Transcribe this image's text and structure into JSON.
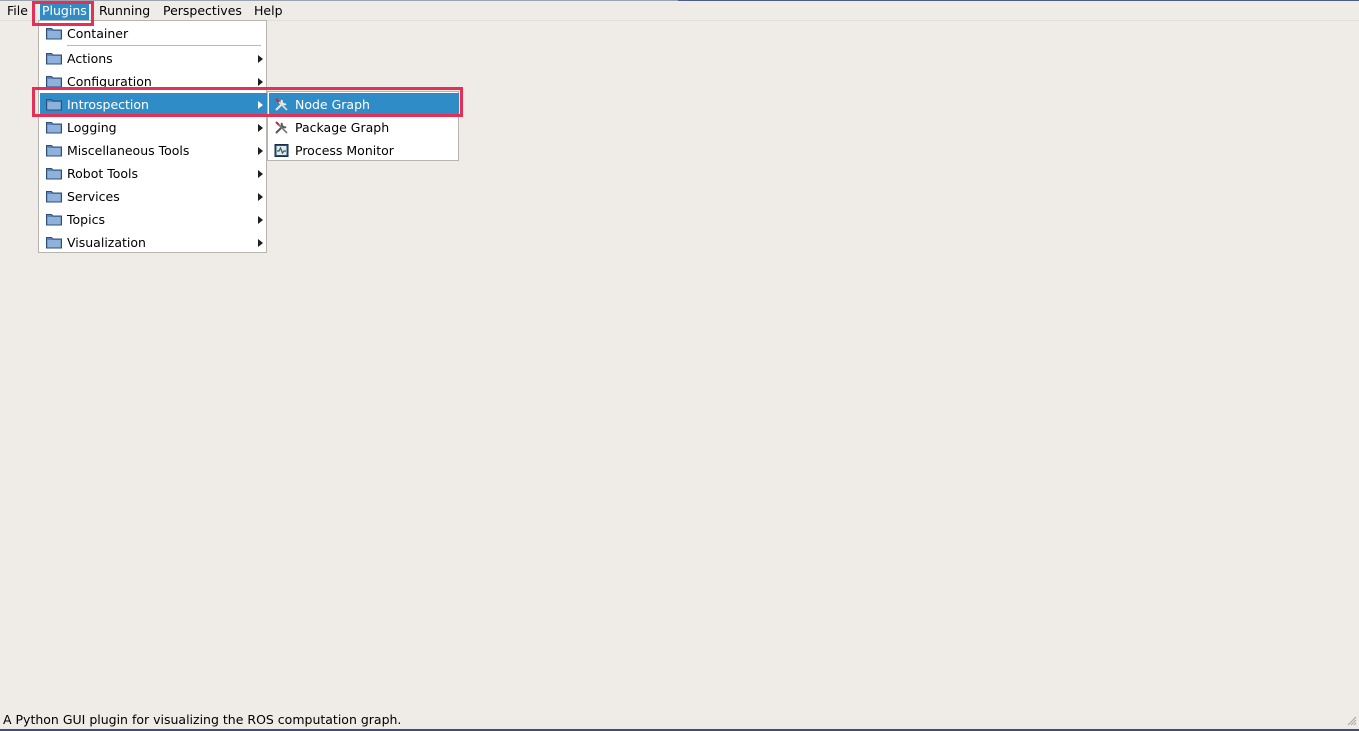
{
  "menubar": {
    "items": [
      {
        "label": "File",
        "mnemonic": "F"
      },
      {
        "label": "Plugins",
        "mnemonic": "P"
      },
      {
        "label": "Running",
        "mnemonic": "R"
      },
      {
        "label": "Perspectives",
        "mnemonic": "P"
      },
      {
        "label": "Help",
        "mnemonic": "H"
      }
    ],
    "active": "Plugins"
  },
  "plugins_menu": {
    "items": [
      {
        "label": "Container",
        "icon": "folder-icon",
        "has_submenu": false
      },
      {
        "label": "Actions",
        "icon": "folder-icon",
        "has_submenu": true
      },
      {
        "label": "Configuration",
        "icon": "folder-icon",
        "has_submenu": true
      },
      {
        "label": "Introspection",
        "icon": "folder-icon",
        "has_submenu": true,
        "highlighted": true
      },
      {
        "label": "Logging",
        "icon": "folder-icon",
        "has_submenu": true
      },
      {
        "label": "Miscellaneous Tools",
        "icon": "folder-icon",
        "has_submenu": true
      },
      {
        "label": "Robot Tools",
        "icon": "folder-icon",
        "has_submenu": true
      },
      {
        "label": "Services",
        "icon": "folder-icon",
        "has_submenu": true
      },
      {
        "label": "Topics",
        "icon": "folder-icon",
        "has_submenu": true
      },
      {
        "label": "Visualization",
        "icon": "folder-icon",
        "has_submenu": true
      }
    ]
  },
  "introspection_submenu": {
    "items": [
      {
        "label": "Node Graph",
        "icon": "wrench-screwdriver-icon",
        "highlighted": true
      },
      {
        "label": "Package Graph",
        "icon": "wrench-screwdriver-icon"
      },
      {
        "label": "Process Monitor",
        "icon": "process-monitor-icon"
      }
    ]
  },
  "statusbar": {
    "text": "A Python GUI plugin for visualizing the ROS computation graph."
  },
  "colors": {
    "window_bg": "#efebe7",
    "highlight": "#308cc6",
    "annotation": "#e62f55",
    "menu_bg": "#ffffff"
  }
}
